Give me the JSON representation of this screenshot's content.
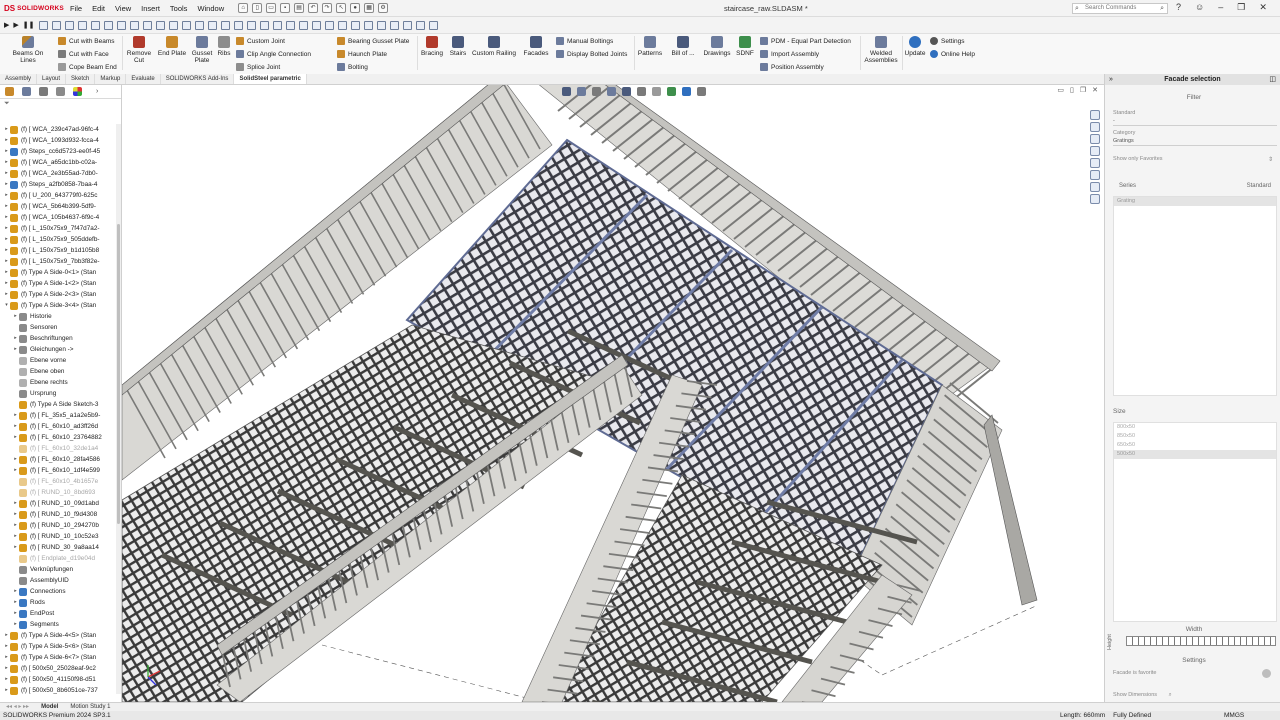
{
  "app": {
    "brand_ds": "DS",
    "brand_name": "SOLIDWORKS",
    "document_title": "staircase_raw.SLDASM *",
    "search_placeholder": "Search Commands"
  },
  "menu": [
    "File",
    "Edit",
    "View",
    "Insert",
    "Tools",
    "Window"
  ],
  "ribbon": {
    "beams_on_lines": "Beams On Lines",
    "cut_with_beams": "Cut with Beams",
    "cut_with_face": "Cut with Face",
    "cope_beam_end": "Cope Beam End",
    "remove_cut": "Remove Cut",
    "end_plate": "End Plate",
    "gusset_plate": "Gusset Plate",
    "ribs": "Ribs",
    "custom_joint": "Custom Joint",
    "clip_angle_connection": "Clip Angle Connection",
    "splice_joint": "Splice Joint",
    "bearing_gusset_plate": "Bearing Gusset Plate",
    "haunch_plate": "Haunch Plate",
    "bolting": "Bolting",
    "bracing": "Bracing",
    "stairs": "Stairs",
    "custom_railing": "Custom Railing",
    "facades": "Facades",
    "manual_boltings": "Manual Boltings",
    "display_bolted_joints": "Display Bolted Joints",
    "patterns": "Patterns",
    "bill_of": "Bill of ...",
    "drawings": "Drawings",
    "sdnf": "SDNF",
    "pdm_equal_part": "PDM - Equal Part Detection",
    "import_assembly": "Import Assembly",
    "position_assembly": "Position Assembly",
    "welded_assemblies": "Welded Assemblies",
    "update": "Update",
    "settings": "Settings",
    "online_help": "Online Help"
  },
  "tabs": [
    "Assembly",
    "Layout",
    "Sketch",
    "Markup",
    "Evaluate",
    "SOLIDWORKS Add-Ins",
    "SolidSteel parametric"
  ],
  "active_tab": "SolidSteel parametric",
  "filter_icon": "funnel-icon",
  "tree": [
    {
      "label": "(f) [ WCA_239c47ad-96fc-4",
      "indent": 0,
      "expand": "▸",
      "icon": "#d99a1a",
      "grey": false
    },
    {
      "label": "(f) [ WCA_1093d932-fcca-4",
      "indent": 0,
      "expand": "▸",
      "icon": "#d99a1a",
      "grey": false
    },
    {
      "label": "(f) Steps_cc6d5723-ee0f-45",
      "indent": 0,
      "expand": "▸",
      "icon": "#3a78c2",
      "grey": false
    },
    {
      "label": "(f) [ WCA_a65dc1bb-c02a-",
      "indent": 0,
      "expand": "▸",
      "icon": "#d99a1a",
      "grey": false
    },
    {
      "label": "(f) [ WCA_2e3b55ad-7db0-",
      "indent": 0,
      "expand": "▸",
      "icon": "#d99a1a",
      "grey": false
    },
    {
      "label": "(f) Steps_a2fb0858-7baa-4",
      "indent": 0,
      "expand": "▸",
      "icon": "#3a78c2",
      "grey": false
    },
    {
      "label": "(f) [ U_200_643779f0-625c",
      "indent": 0,
      "expand": "▸",
      "icon": "#d99a1a",
      "grey": false
    },
    {
      "label": "(f) [ WCA_5b64b399-5df9-",
      "indent": 0,
      "expand": "▸",
      "icon": "#d99a1a",
      "grey": false
    },
    {
      "label": "(f) [ WCA_105b4637-6f9c-4",
      "indent": 0,
      "expand": "▸",
      "icon": "#d99a1a",
      "grey": false
    },
    {
      "label": "(f) [ L_150x75x9_7f47d7a2-",
      "indent": 0,
      "expand": "▸",
      "icon": "#d99a1a",
      "grey": false
    },
    {
      "label": "(f) [ L_150x75x9_505ddefb-",
      "indent": 0,
      "expand": "▸",
      "icon": "#d99a1a",
      "grey": false
    },
    {
      "label": "(f) [ L_150x75x9_b1d105b8",
      "indent": 0,
      "expand": "▸",
      "icon": "#d99a1a",
      "grey": false
    },
    {
      "label": "(f) [ L_150x75x9_7bb3f82e-",
      "indent": 0,
      "expand": "▸",
      "icon": "#d99a1a",
      "grey": false
    },
    {
      "label": "(f) Type A Side-0<1> (Stan",
      "indent": 0,
      "expand": "▸",
      "icon": "#d99a1a",
      "grey": false
    },
    {
      "label": "(f) Type A Side-1<2> (Stan",
      "indent": 0,
      "expand": "▸",
      "icon": "#d99a1a",
      "grey": false
    },
    {
      "label": "(f) Type A Side-2<3> (Stan",
      "indent": 0,
      "expand": "▸",
      "icon": "#d99a1a",
      "grey": false
    },
    {
      "label": "(f) Type A Side-3<4> (Stan",
      "indent": 0,
      "expand": "▾",
      "icon": "#d99a1a",
      "grey": false
    },
    {
      "label": "Historie",
      "indent": 1,
      "expand": "▸",
      "icon": "#8a8a8a",
      "grey": false
    },
    {
      "label": "Sensoren",
      "indent": 1,
      "expand": "",
      "icon": "#8a8a8a",
      "grey": false
    },
    {
      "label": "Beschriftungen",
      "indent": 1,
      "expand": "▸",
      "icon": "#8a8a8a",
      "grey": false
    },
    {
      "label": "Gleichungen ->",
      "indent": 1,
      "expand": "▸",
      "icon": "#8a8a8a",
      "grey": false
    },
    {
      "label": "Ebene vorne",
      "indent": 1,
      "expand": "",
      "icon": "#b0b0b0",
      "grey": false
    },
    {
      "label": "Ebene oben",
      "indent": 1,
      "expand": "",
      "icon": "#b0b0b0",
      "grey": false
    },
    {
      "label": "Ebene rechts",
      "indent": 1,
      "expand": "",
      "icon": "#b0b0b0",
      "grey": false
    },
    {
      "label": "Ursprung",
      "indent": 1,
      "expand": "",
      "icon": "#8a8a8a",
      "grey": false
    },
    {
      "label": "(f) Type A Side Sketch-3",
      "indent": 1,
      "expand": "",
      "icon": "#d99a1a",
      "grey": false
    },
    {
      "label": "(f) [ FL_35x5_a1a2e5b9-",
      "indent": 1,
      "expand": "▸",
      "icon": "#d99a1a",
      "grey": false
    },
    {
      "label": "(f) [ FL_60x10_ad3ff26d",
      "indent": 1,
      "expand": "▸",
      "icon": "#d99a1a",
      "grey": false
    },
    {
      "label": "(f) [ FL_60x10_23764882",
      "indent": 1,
      "expand": "▸",
      "icon": "#d99a1a",
      "grey": false
    },
    {
      "label": "(f) [ FL_60x10_32de1a4",
      "indent": 1,
      "expand": "",
      "icon": "#e9c98a",
      "grey": true
    },
    {
      "label": "(f) [ FL_60x10_28fa4586",
      "indent": 1,
      "expand": "▸",
      "icon": "#d99a1a",
      "grey": false
    },
    {
      "label": "(f) [ FL_60x10_1df4e599",
      "indent": 1,
      "expand": "▸",
      "icon": "#d99a1a",
      "grey": false
    },
    {
      "label": "(f) [ FL_60x10_4b1657e",
      "indent": 1,
      "expand": "",
      "icon": "#e9c98a",
      "grey": true
    },
    {
      "label": "(f) [ RUND_10_8bd693",
      "indent": 1,
      "expand": "",
      "icon": "#e9c98a",
      "grey": true
    },
    {
      "label": "(f) [ RUND_10_09d1abd",
      "indent": 1,
      "expand": "▸",
      "icon": "#d99a1a",
      "grey": false
    },
    {
      "label": "(f) [ RUND_10_f9d4308",
      "indent": 1,
      "expand": "▸",
      "icon": "#d99a1a",
      "grey": false
    },
    {
      "label": "(f) [ RUND_10_294270b",
      "indent": 1,
      "expand": "▸",
      "icon": "#d99a1a",
      "grey": false
    },
    {
      "label": "(f) [ RUND_10_10c52e3",
      "indent": 1,
      "expand": "▸",
      "icon": "#d99a1a",
      "grey": false
    },
    {
      "label": "(f) [ RUND_30_9a8aa14",
      "indent": 1,
      "expand": "▸",
      "icon": "#d99a1a",
      "grey": false
    },
    {
      "label": "(f) [ Endplate_d19e04d",
      "indent": 1,
      "expand": "",
      "icon": "#e9c98a",
      "grey": true
    },
    {
      "label": "Verknüpfungen",
      "indent": 1,
      "expand": "",
      "icon": "#8a8a8a",
      "grey": false
    },
    {
      "label": "AssemblyUID",
      "indent": 1,
      "expand": "",
      "icon": "#8a8a8a",
      "grey": false
    },
    {
      "label": "Connections",
      "indent": 1,
      "expand": "▸",
      "icon": "#3a78c2",
      "grey": false
    },
    {
      "label": "Rods",
      "indent": 1,
      "expand": "▸",
      "icon": "#3a78c2",
      "grey": false
    },
    {
      "label": "EndPost",
      "indent": 1,
      "expand": "▸",
      "icon": "#3a78c2",
      "grey": false
    },
    {
      "label": "Segments",
      "indent": 1,
      "expand": "▸",
      "icon": "#3a78c2",
      "grey": false
    },
    {
      "label": "(f) Type A Side-4<5> (Stan",
      "indent": 0,
      "expand": "▸",
      "icon": "#d99a1a",
      "grey": false
    },
    {
      "label": "(f) Type A Side-5<6> (Stan",
      "indent": 0,
      "expand": "▸",
      "icon": "#d99a1a",
      "grey": false
    },
    {
      "label": "(f) Type A Side-6<7> (Stan",
      "indent": 0,
      "expand": "▸",
      "icon": "#d99a1a",
      "grey": false
    },
    {
      "label": "(f) [ 500x50_25028eaf-9c2",
      "indent": 0,
      "expand": "▸",
      "icon": "#d99a1a",
      "grey": false
    },
    {
      "label": "(f) [ 500x50_41150f98-d51",
      "indent": 0,
      "expand": "▸",
      "icon": "#d99a1a",
      "grey": false
    },
    {
      "label": "(f) [ 500x50_8b6051ce-737",
      "indent": 0,
      "expand": "▸",
      "icon": "#d99a1a",
      "grey": false
    }
  ],
  "facade_panel": {
    "title": "Facade selection",
    "filter_label": "Filter",
    "standard_label": "Standard",
    "standard_value": "-",
    "category_label": "Category",
    "category_value": "Gratings",
    "show_only_favorites": "Show only Favorites",
    "series_col": "Series",
    "standard_col": "Standard",
    "series_items": [
      "Grating"
    ],
    "size_label": "Size",
    "sizes": [
      "800x50",
      "850x50",
      "650x50",
      "500x50"
    ],
    "selected_size": "500x50",
    "width_label": "Width",
    "height_label": "Height",
    "settings_label": "Settings",
    "facade_is_favorite": "Facade is favorite",
    "show_dimensions": "Show Dimensions"
  },
  "bottom_tabs": [
    "Model",
    "Motion Study 1"
  ],
  "status": {
    "product": "SOLIDWORKS Premium 2024 SP3.1",
    "length": "Length: 660mm",
    "state": "Fully Defined",
    "units": "MMGS"
  },
  "colors": {
    "brand": "#d6001c",
    "steel": "#cfcfcc",
    "grating": "#3a3a3a",
    "selected_blue": "#6f7ca6"
  }
}
